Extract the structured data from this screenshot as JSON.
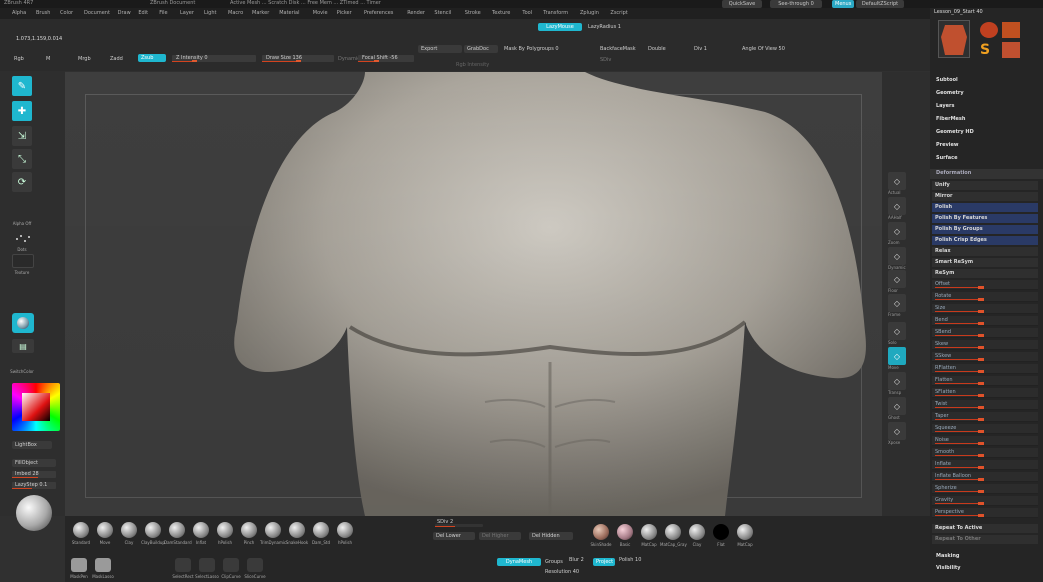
{
  "title": {
    "app": "ZBrush 4R7",
    "doc": "ZBrush Document",
    "stats": "Active Mesh ... Scratch Disk ... Free Mem ... ZTimed ... Timer"
  },
  "top_right": {
    "quicksave": "QuickSave",
    "seethrough": "See-through 0",
    "menus": "Menus",
    "script": "DefaultZScript"
  },
  "menu": [
    "Alpha",
    "Brush",
    "Color",
    "Document",
    "Draw",
    "Edit",
    "File",
    "Layer",
    "Light",
    "Macro",
    "Marker",
    "Material",
    "Movie",
    "Picker",
    "Preferences",
    "Render",
    "Stencil",
    "Stroke",
    "Texture",
    "Tool",
    "Transform",
    "Zplugin",
    "Zscript"
  ],
  "coords": "1.073,1.159,0.014",
  "toolbar": {
    "rgb": "Rgb",
    "m": "M",
    "mrgb": "Mrgb",
    "zadd": "Zadd",
    "zsub": "Zsub",
    "zintensity": "Z Intensity 0",
    "drawsize": "Draw Size 136",
    "dynamic": "Dynamic",
    "focal": "Focal Shift -56",
    "rgbintensity": "Rgb Intensity",
    "lazymouse": "LazyMouse",
    "lazyradius": "LazyRadius 1",
    "export": "Export",
    "grabdoc": "GrabDoc",
    "maskpoly": "Mask By Polygroups 0",
    "backface": "BackfaceMask",
    "double": "Double",
    "div": "Div 1",
    "angle": "Angle Of View 50",
    "sdiv": "SDiv"
  },
  "left_shelf": {
    "edit": "Edit",
    "draw": "Draw",
    "move": "Move",
    "scale": "Scale",
    "rotate": "Rotate",
    "alpha": "Alpha Off",
    "dots": "Dots",
    "texture": "Texture",
    "material": "Material",
    "gradient": "Gradient",
    "switch": "SwitchColor",
    "lightbox": "LightBox",
    "fillobject": "FillObject",
    "imbed": "Imbed 28",
    "lazystep": "LazyStep 0.1",
    "matcap": "Cartoony"
  },
  "right_shelf": [
    "Actual",
    "AAHalf",
    "Zoom",
    "Dynamic",
    "Floor",
    "Frame",
    "Solo",
    "Move",
    "Transp",
    "Ghost",
    "Xpose"
  ],
  "palette": {
    "subtool_label": "Lesson_09_Start 40",
    "thumbs": [
      "Cylinder3D",
      "PolyMesh3D",
      "SimpleBrush",
      "ZSphere"
    ],
    "sections": [
      "Subtool",
      "Geometry",
      "Layers",
      "FiberMesh",
      "Geometry HD",
      "Preview",
      "Surface"
    ],
    "deformation_header": "Deformation",
    "deform_top": [
      "Unify",
      "Mirror",
      "Polish",
      "Polish By Features",
      "Polish By Groups",
      "Polish Crisp Edges",
      "Relax",
      "Smart ReSym",
      "ReSym"
    ],
    "deform_sliders": [
      "Offset",
      "Rotate",
      "Size",
      "Bend",
      "SBend",
      "Skew",
      "SSkew",
      "RFlatten",
      "Flatten",
      "SFlatten",
      "Twist",
      "Taper",
      "Squeeze",
      "Noise",
      "Smooth",
      "Inflate",
      "Inflate Balloon",
      "Spherize",
      "Gravity",
      "Perspective"
    ],
    "repeat_active": "Repeat To Active",
    "repeat_other": "Repeat To Other",
    "masking": "Masking",
    "visibility": "Visibility"
  },
  "bottom": {
    "brushes": [
      "Standard",
      "Move",
      "Clay",
      "ClayBuildup",
      "DamStandard",
      "Inflat",
      "hPolish",
      "Pinch",
      "TrimDynamic",
      "SnakeHook",
      "Dam_Std",
      "hPolish",
      "TrimDynamic",
      "ZModeler"
    ],
    "sdiv": "SDiv 2",
    "dellower": "Del Lower",
    "delhigher": "Del Higher",
    "delhidden": "Del Hidden",
    "materials": [
      "SkinShade",
      "Basic",
      "MatCap",
      "MatCap_Gray",
      "Clay",
      "Flat",
      "MatCap"
    ],
    "polish": "Polish 10",
    "dynamesh": "DynaMesh",
    "groups": "Groups",
    "blur": "Blur 2",
    "resolution": "Resolution 40",
    "project": "Project",
    "icons": [
      "MaskPen",
      "MaskLasso",
      "SelectRect",
      "SelectLasso",
      "ClipCurve",
      "SliceCurve"
    ]
  },
  "colors": {
    "accent": "#1fb7cf",
    "slider": "#d2431f",
    "bg": "#303030"
  }
}
